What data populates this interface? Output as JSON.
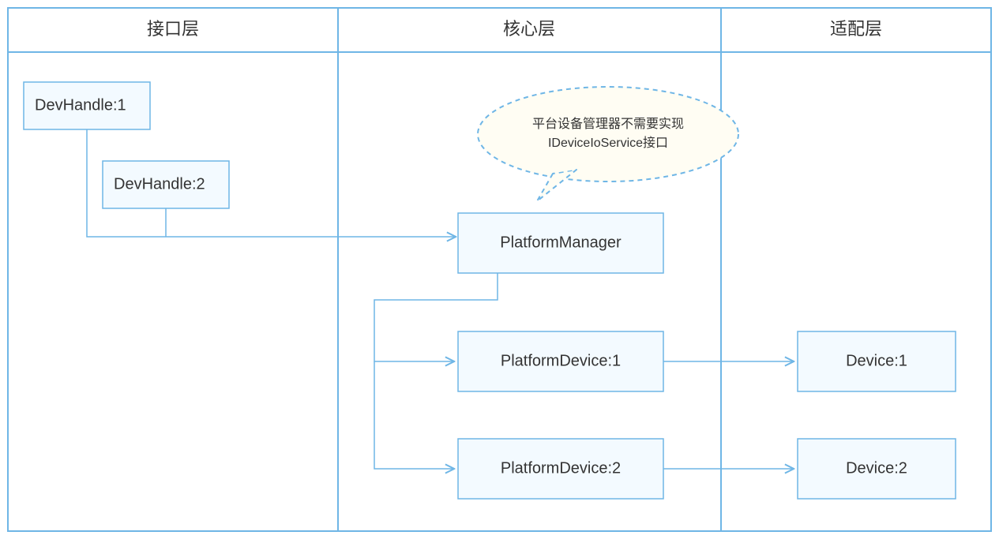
{
  "headers": {
    "interface": "接口层",
    "core": "核心层",
    "adapter": "适配层"
  },
  "nodes": {
    "devHandle1": "DevHandle:1",
    "devHandle2": "DevHandle:2",
    "platformManager": "PlatformManager",
    "platformDevice1": "PlatformDevice:1",
    "platformDevice2": "PlatformDevice:2",
    "device1": "Device:1",
    "device2": "Device:2"
  },
  "callout": {
    "line1": "平台设备管理器不需要实现",
    "line2": "IDeviceIoService接口"
  },
  "layout": {
    "columns": [
      "接口层",
      "核心层",
      "适配层"
    ],
    "edges": [
      {
        "from": "devHandle1",
        "to": "platformManager"
      },
      {
        "from": "devHandle2",
        "to": "platformManager"
      },
      {
        "from": "platformManager",
        "to": "platformDevice1"
      },
      {
        "from": "platformManager",
        "to": "platformDevice2"
      },
      {
        "from": "platformDevice1",
        "to": "device1"
      },
      {
        "from": "platformDevice2",
        "to": "device2"
      }
    ],
    "calloutTarget": "platformManager"
  }
}
